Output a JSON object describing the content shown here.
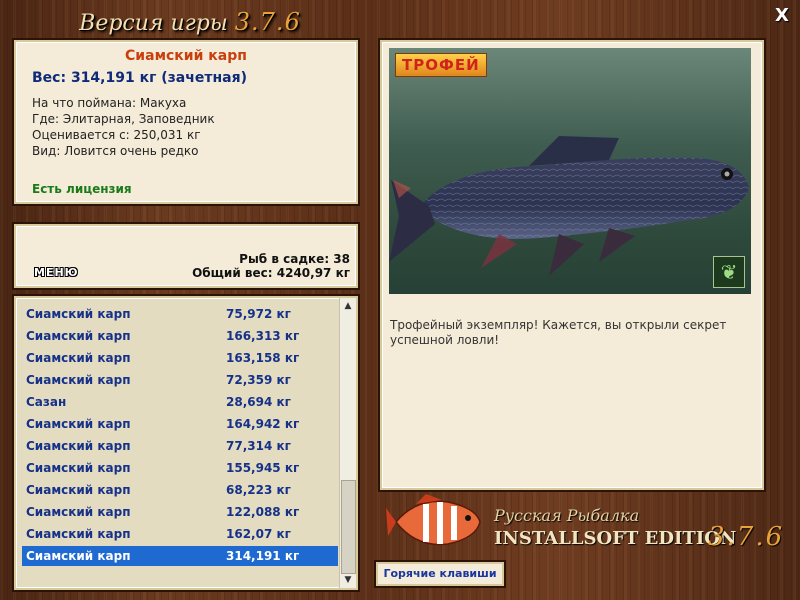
{
  "window": {
    "title_prefix": "Версия игры",
    "title_version": "3.7.6",
    "close_symbol": "X"
  },
  "catch_info": {
    "name": "Сиамский карп",
    "weight_line": "Вес: 314,191 кг (зачетная)",
    "bait_line": "На что поймана: Макуха",
    "place_line": "Где: Элитарная, Заповедник",
    "threshold_line": "Оценивается с: 250,031 кг",
    "rarity_line": "Вид: Ловится очень редко",
    "license": "Есть лицензия"
  },
  "stats": {
    "menu_label": "МЕНЮ",
    "fish_count": "Рыб в садке: 38",
    "total_weight": "Общий вес: 4240,97 кг"
  },
  "catch_list": {
    "rows": [
      {
        "name": "Сиамский карп",
        "weight": "75,972 кг"
      },
      {
        "name": "Сиамский карп",
        "weight": "166,313 кг"
      },
      {
        "name": "Сиамский карп",
        "weight": "163,158 кг"
      },
      {
        "name": "Сиамский карп",
        "weight": "72,359 кг"
      },
      {
        "name": "Сазан",
        "weight": "28,694 кг"
      },
      {
        "name": "Сиамский карп",
        "weight": "164,942 кг"
      },
      {
        "name": "Сиамский карп",
        "weight": "77,314 кг"
      },
      {
        "name": "Сиамский карп",
        "weight": "155,945 кг"
      },
      {
        "name": "Сиамский карп",
        "weight": "68,223 кг"
      },
      {
        "name": "Сиамский карп",
        "weight": "122,088 кг"
      },
      {
        "name": "Сиамский карп",
        "weight": "162,07 кг"
      },
      {
        "name": "Сиамский карп",
        "weight": "314,191 кг"
      }
    ],
    "selected_row": 11
  },
  "photo": {
    "badge": "ТРОФЕЙ",
    "description": "Трофейный экземпляр! Кажется, вы открыли секрет успешной ловли!",
    "icon": "butterfly-icon"
  },
  "logo": {
    "subtitle": "Русская Рыбалка",
    "edition": "INSTALLSOFT EDITION",
    "version": "3.7.6"
  },
  "hotkeys_label": "Горячие клавиши",
  "colors": {
    "fish_name": "#c8400e",
    "weight": "#102a7a",
    "license": "#1b7a1b",
    "list_text": "#16318a",
    "selection": "#1f6ad0"
  }
}
